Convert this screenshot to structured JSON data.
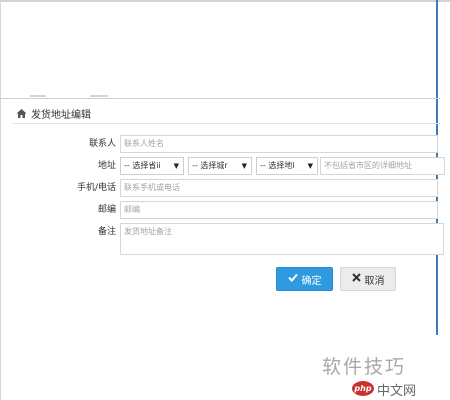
{
  "dialog": {
    "title": "发货地址编辑",
    "icon": "home-icon"
  },
  "form": {
    "contact": {
      "label": "联系人",
      "placeholder": "联系人姓名"
    },
    "address": {
      "label": "地址",
      "province": "-- 选择省ii",
      "city": "-- 选择城r",
      "district": "-- 选择地l",
      "detail_placeholder": "不包括省市区的详细地址"
    },
    "phone": {
      "label": "手机/电话",
      "placeholder": "联系手机或电话"
    },
    "zipcode": {
      "label": "邮编",
      "placeholder": "邮编"
    },
    "remark": {
      "label": "备注",
      "placeholder": "发货地址备注"
    }
  },
  "buttons": {
    "confirm": "确定",
    "cancel": "取消"
  },
  "watermark": {
    "text": "软件技巧",
    "badge": "php",
    "site": "中文网"
  },
  "colors": {
    "primary": "#2e9ae0",
    "cancel_bg": "#ececec",
    "accent_line": "#3d7ab8"
  }
}
